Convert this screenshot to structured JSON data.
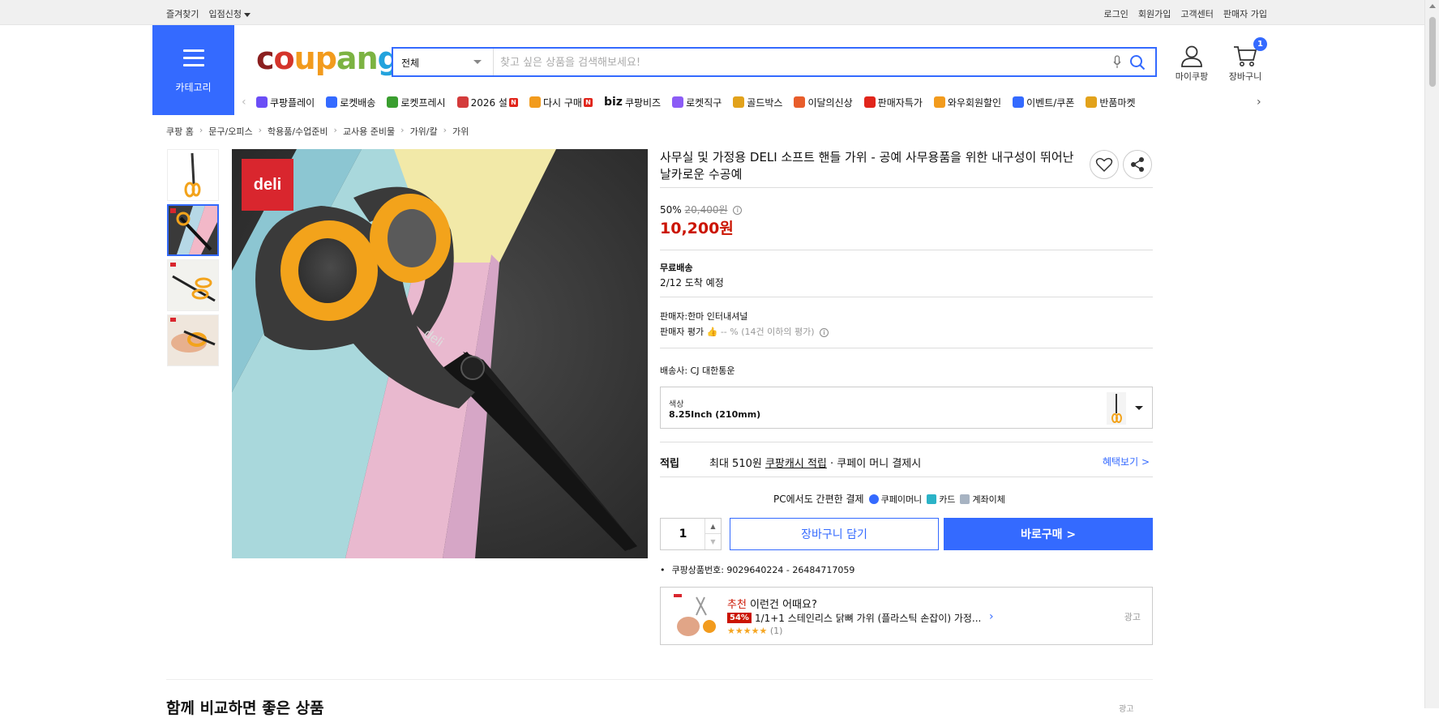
{
  "topbar": {
    "left": [
      "즐겨찾기",
      "입점신청"
    ],
    "right": [
      "로그인",
      "회원가입",
      "고객센터",
      "판매자 가입"
    ]
  },
  "header": {
    "category_label": "카테고리",
    "logo": [
      "c",
      "o",
      "u",
      "p",
      "a",
      "n",
      "g"
    ],
    "search": {
      "scope": "전체",
      "placeholder": "찾고 싶은 상품을 검색해보세요!"
    },
    "mycoupang_label": "마이쿠팡",
    "cart_label": "장바구니",
    "cart_count": "1"
  },
  "nav": [
    {
      "label": "쿠팡플레이",
      "icon": "play-icon",
      "color": "#6b4ef6"
    },
    {
      "label": "로켓배송",
      "icon": "rocket-icon",
      "color": "#346aff"
    },
    {
      "label": "로켓프레시",
      "icon": "rocket-fresh-icon",
      "color": "#3a9e2f"
    },
    {
      "label": "2026 설",
      "icon": "gift-icon",
      "color": "#d43b3b",
      "new": true
    },
    {
      "label": "다시 구매",
      "icon": "home-icon",
      "color": "#f29b1d",
      "new": true
    },
    {
      "label": "쿠팡비즈",
      "icon": "biz-icon",
      "biz": "biz"
    },
    {
      "label": "로켓직구",
      "icon": "globe-icon",
      "color": "#8c5cf6"
    },
    {
      "label": "골드박스",
      "icon": "goldbox-icon",
      "color": "#e2a21b"
    },
    {
      "label": "이달의신상",
      "icon": "bag-icon",
      "color": "#e85d2b"
    },
    {
      "label": "판매자특가",
      "icon": "percent-icon",
      "color": "#e1251b"
    },
    {
      "label": "와우회원할인",
      "icon": "wow-icon",
      "color": "#f29b1d"
    },
    {
      "label": "이벤트/쿠폰",
      "icon": "coupon-icon",
      "color": "#346aff"
    },
    {
      "label": "반품마켓",
      "icon": "market-icon",
      "color": "#e2a21b"
    }
  ],
  "new_badge": "N",
  "breadcrumb": [
    "쿠팡 홈",
    "문구/오피스",
    "학용품/수업준비",
    "교사용 준비물",
    "가위/칼",
    "가위"
  ],
  "gallery": {
    "brand_badge": "deli",
    "blade_text": "deli"
  },
  "product": {
    "title": "사무실 및 가정용 DELI 소프트 핸들 가위 - 공예 사무용품을 위한 내구성이 뛰어난 날카로운 수공예",
    "discount_rate": "50%",
    "original_price": "20,400원",
    "price": "10,200원",
    "shipping_title": "무료배송",
    "shipping_date": "2/12 도착 예정",
    "seller": "판매자:한마 인터내셔널",
    "seller_rate_label": "판매자 평가",
    "seller_rate_value": "-- % (14건 이하의 평가)",
    "carrier": "배송사:  CJ 대한통운",
    "option_label": "색상",
    "option_value": "8.25Inch (210mm)",
    "reward_label": "적립",
    "reward_max": "최대 510원",
    "reward_link": "쿠팡캐시 적립",
    "reward_tail": " · 쿠페이 머니 결제시",
    "reward_more": "혜택보기 >",
    "pay_prefix": "PC에서도 간편한 결제",
    "pay_methods": [
      {
        "label": "쿠페이머니",
        "color": "#346aff"
      },
      {
        "label": "카드",
        "color": "#2bb3c7"
      },
      {
        "label": "계좌이체",
        "color": "#a7b3c2"
      }
    ],
    "quantity": "1",
    "cart_button": "장바구니 담기",
    "buy_button": "바로구매 >",
    "product_number": "쿠팡상품번호: 9029640224 - 26484717059"
  },
  "recommendation": {
    "head_red": "추천",
    "head": " 이런건 어때요?",
    "discount": "54%",
    "name": "1/1+1 스테인리스 닭뼈 가위 (플라스틱 손잡이) 가정...",
    "stars": "★★★★★",
    "count": "(1)",
    "ad": "광고"
  },
  "bottom": {
    "title": "함께 비교하면 좋은 상품",
    "ad": "광고"
  }
}
